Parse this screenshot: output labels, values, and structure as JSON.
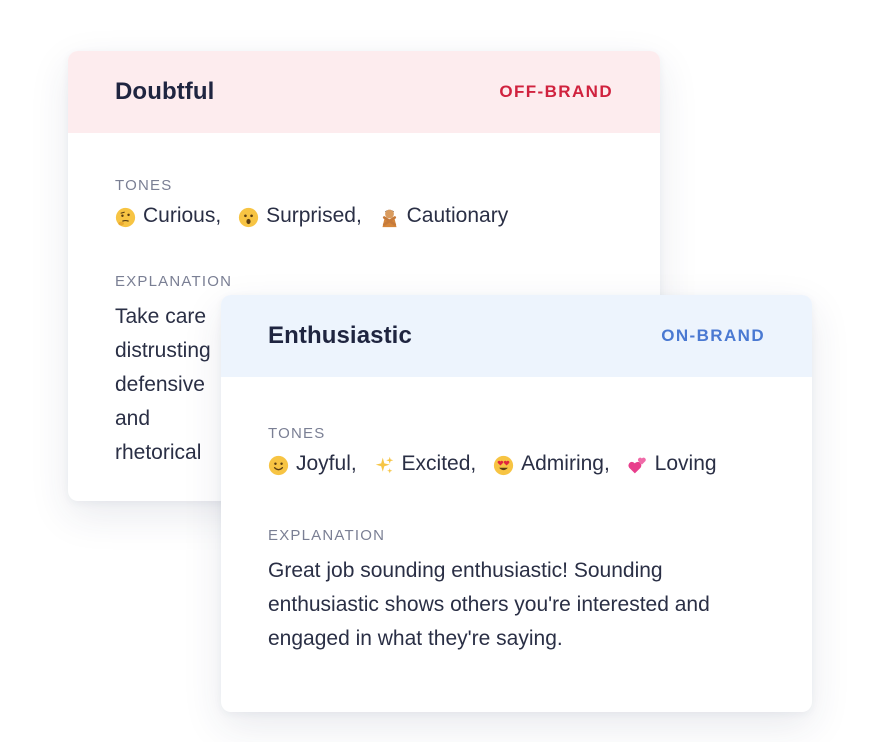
{
  "cards": [
    {
      "title": "Doubtful",
      "badge": "OFF-BRAND",
      "badge_color": "#d0223e",
      "header_bg": "#fdecee",
      "tones_label": "TONES",
      "tones": [
        {
          "icon": "thinking-face-icon",
          "label": "Curious"
        },
        {
          "icon": "surprised-face-icon",
          "label": "Surprised"
        },
        {
          "icon": "person-gesturing-no-icon",
          "label": "Cautionary"
        }
      ],
      "explanation_label": "EXPLANATION",
      "explanation": "Take care distrusting defensive and rhetorical"
    },
    {
      "title": "Enthusiastic",
      "badge": "ON-BRAND",
      "badge_color": "#4a79d2",
      "header_bg": "#edf4fd",
      "tones_label": "TONES",
      "tones": [
        {
          "icon": "smiling-face-icon",
          "label": "Joyful"
        },
        {
          "icon": "sparkles-icon",
          "label": "Excited"
        },
        {
          "icon": "heart-eyes-face-icon",
          "label": "Admiring"
        },
        {
          "icon": "two-hearts-icon",
          "label": "Loving"
        }
      ],
      "explanation_label": "EXPLANATION",
      "explanation": "Great job sounding enthusiastic! Sounding enthusiastic shows others you're interested and engaged in what they're saying."
    }
  ]
}
